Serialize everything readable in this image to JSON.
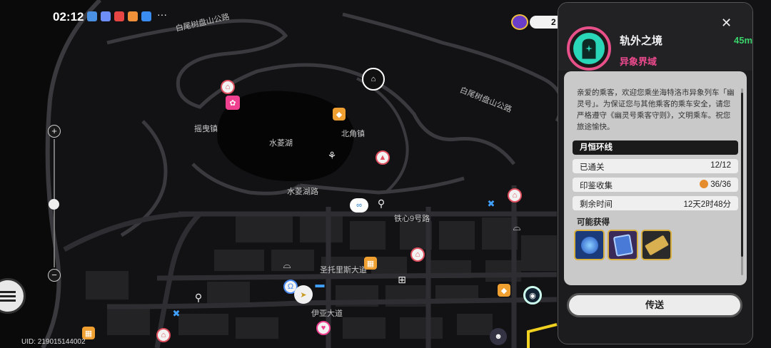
{
  "status_bar": {
    "time": "02:12",
    "more": "···",
    "app_colors": [
      "#4a90e2",
      "#6e8ef7",
      "#e84545",
      "#f0913a",
      "#3a8cf0"
    ]
  },
  "map": {
    "place_labels": {
      "road_baiwei_top": "白尾树盘山公路",
      "road_baiwei_right": "白尾树盘山公路",
      "yaoye": "摇曳镇",
      "shuiling_lake": "水菱湖",
      "beijiao": "北角镇",
      "shuiling_road": "水菱湖路",
      "tiexin": "铁心9号路",
      "santoli": "圣托里斯大道",
      "yiya": "伊亚大道"
    },
    "currency_value": "2"
  },
  "uid": "UID: 219015144002",
  "panel": {
    "title": "轨外之境",
    "subtitle": "异象界域",
    "ping": "45ms",
    "description": "亲爱的乘客，欢迎您乘坐海特洛市异象列车「幽灵号」。为保证您与其他乘客的乘车安全，请您严格遵守《幽灵号乘客守则》，文明乘车。祝您旅途愉快。",
    "section_title": "月恒环线",
    "stats": [
      {
        "label": "已通关",
        "value": "12/12"
      },
      {
        "label": "印鉴收集",
        "value": "36/36"
      },
      {
        "label": "剩余时间",
        "value": "12天2时48分"
      }
    ],
    "rewards_title": "可能获得",
    "reward_icons": [
      "blue-orb-icon",
      "card-book-icon",
      "ticket-icon"
    ],
    "teleport_label": "传送"
  }
}
